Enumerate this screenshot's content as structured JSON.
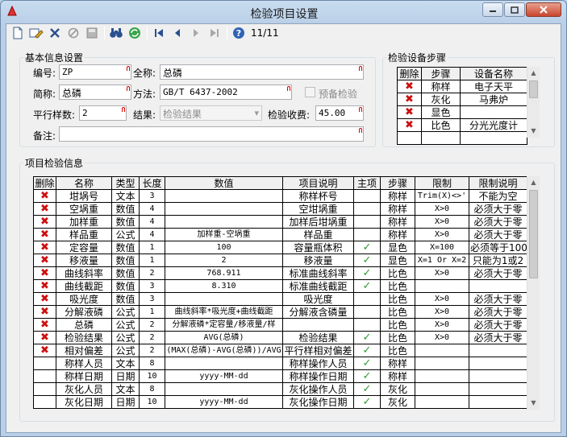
{
  "window": {
    "title": "检验项目设置"
  },
  "toolbar": {
    "page_indicator": "11/11"
  },
  "basic": {
    "legend": "基本信息设置",
    "code_label": "编号:",
    "code_value": "ZP",
    "fullname_label": "全称:",
    "fullname_value": "总磷",
    "shortname_label": "简称:",
    "shortname_value": "总磷",
    "method_label": "方法:",
    "method_value": "GB/T 6437-2002",
    "prep_label": "预备检验",
    "parallel_label": "平行样数:",
    "parallel_value": "2",
    "result_label": "结果:",
    "result_value": "检验结果",
    "fee_label": "检验收费:",
    "fee_value": "45.00",
    "remark_label": "备注:",
    "remark_value": ""
  },
  "equipment": {
    "legend": "检验设备步骤",
    "headers": [
      "删除",
      "步骤",
      "设备名称"
    ],
    "rows": [
      {
        "step": "称样",
        "device": "电子天平"
      },
      {
        "step": "灰化",
        "device": "马弗炉"
      },
      {
        "step": "显色",
        "device": ""
      },
      {
        "step": "比色",
        "device": "分光光度计"
      }
    ]
  },
  "items": {
    "legend": "项目检验信息",
    "headers": [
      "删除",
      "名称",
      "类型",
      "长度",
      "数值",
      "项目说明",
      "主项",
      "步骤",
      "限制",
      "限制说明"
    ],
    "rows": [
      {
        "del": true,
        "name": "坩埚号",
        "type": "文本",
        "len": "3",
        "value": "",
        "desc": "称样杯号",
        "main": false,
        "step": "称样",
        "limit": "Trim(X)<>'",
        "limit_desc": "不能为空"
      },
      {
        "del": true,
        "name": "空埚重",
        "type": "数值",
        "len": "4",
        "value": "",
        "desc": "空坩埚重",
        "main": false,
        "step": "称样",
        "limit": "X>0",
        "limit_desc": "必须大于零"
      },
      {
        "del": true,
        "name": "加样重",
        "type": "数值",
        "len": "4",
        "value": "",
        "desc": "加样后坩埚重",
        "main": false,
        "step": "称样",
        "limit": "X>0",
        "limit_desc": "必须大于零"
      },
      {
        "del": true,
        "name": "样品重",
        "type": "公式",
        "len": "4",
        "value": "加样重-空埚重",
        "desc": "样品重",
        "main": false,
        "step": "称样",
        "limit": "X>0",
        "limit_desc": "必须大于零"
      },
      {
        "del": true,
        "name": "定容量",
        "type": "数值",
        "len": "1",
        "value": "100",
        "desc": "容量瓶体积",
        "main": true,
        "step": "显色",
        "limit": "X=100",
        "limit_desc": "必须等于100"
      },
      {
        "del": true,
        "name": "移液量",
        "type": "数值",
        "len": "1",
        "value": "2",
        "desc": "移液量",
        "main": true,
        "step": "显色",
        "limit": "X=1 Or X=2",
        "limit_desc": "只能为1或2"
      },
      {
        "del": true,
        "name": "曲线斜率",
        "type": "数值",
        "len": "2",
        "value": "768.911",
        "desc": "标准曲线斜率",
        "main": true,
        "step": "比色",
        "limit": "X>0",
        "limit_desc": "必须大于零"
      },
      {
        "del": true,
        "name": "曲线截距",
        "type": "数值",
        "len": "3",
        "value": "8.310",
        "desc": "标准曲线截距",
        "main": true,
        "step": "比色",
        "limit": "",
        "limit_desc": ""
      },
      {
        "del": true,
        "name": "吸光度",
        "type": "数值",
        "len": "3",
        "value": "",
        "desc": "吸光度",
        "main": false,
        "step": "比色",
        "limit": "X>0",
        "limit_desc": "必须大于零"
      },
      {
        "del": true,
        "name": "分解液磷",
        "type": "公式",
        "len": "1",
        "value": "曲线斜率*吸光度+曲线截距",
        "desc": "分解液含磷量",
        "main": false,
        "step": "比色",
        "limit": "X>0",
        "limit_desc": "必须大于零"
      },
      {
        "del": true,
        "name": "总磷",
        "type": "公式",
        "len": "2",
        "value": "分解液磷*定容量/移液量/样",
        "desc": "",
        "main": false,
        "step": "比色",
        "limit": "X>0",
        "limit_desc": "必须大于零"
      },
      {
        "del": true,
        "name": "检验结果",
        "type": "公式",
        "len": "2",
        "value": "AVG(总磷)",
        "desc": "检验结果",
        "main": true,
        "step": "比色",
        "limit": "X>0",
        "limit_desc": "必须大于零"
      },
      {
        "del": true,
        "name": "相对偏差",
        "type": "公式",
        "len": "2",
        "value": "(MAX(总磷)-AVG(总磷))/AVG",
        "desc": "平行样相对偏差",
        "main": true,
        "step": "比色",
        "limit": "",
        "limit_desc": ""
      },
      {
        "del": false,
        "name": "称样人员",
        "type": "文本",
        "len": "8",
        "value": "",
        "desc": "称样操作人员",
        "main": true,
        "step": "称样",
        "limit": "",
        "limit_desc": ""
      },
      {
        "del": false,
        "name": "称样日期",
        "type": "日期",
        "len": "10",
        "value": "yyyy-MM-dd",
        "desc": "称样操作日期",
        "main": true,
        "step": "称样",
        "limit": "",
        "limit_desc": ""
      },
      {
        "del": false,
        "name": "灰化人员",
        "type": "文本",
        "len": "8",
        "value": "",
        "desc": "灰化操作人员",
        "main": true,
        "step": "灰化",
        "limit": "",
        "limit_desc": ""
      },
      {
        "del": false,
        "name": "灰化日期",
        "type": "日期",
        "len": "10",
        "value": "yyyy-MM-dd",
        "desc": "灰化操作日期",
        "main": true,
        "step": "灰化",
        "limit": "",
        "limit_desc": ""
      }
    ]
  }
}
